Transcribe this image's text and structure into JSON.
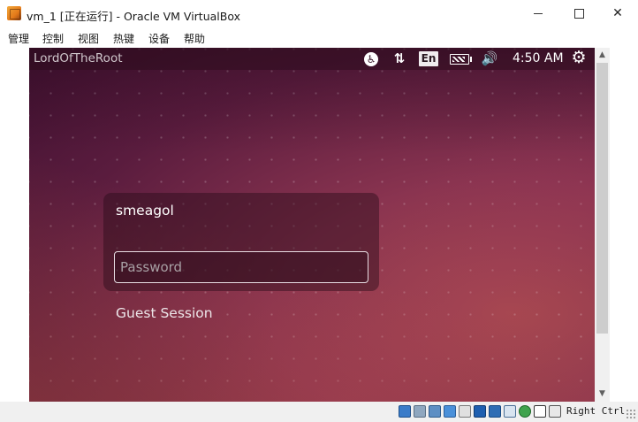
{
  "window": {
    "title": "vm_1 [正在运行] - Oracle VM VirtualBox",
    "app_icon": "virtualbox-icon"
  },
  "controls": {
    "minimize": "minimize",
    "maximize": "maximize",
    "close": "✕"
  },
  "menubar": {
    "items": [
      "管理",
      "控制",
      "视图",
      "热键",
      "设备",
      "帮助"
    ]
  },
  "vm": {
    "panel": {
      "hostname": "LordOfTheRoot",
      "accessibility_icon": "accessibility-icon",
      "network_icon": "network-updown-icon",
      "network_glyph": "⇅",
      "keyboard_layout": "En",
      "battery_icon": "battery-icon",
      "volume_icon": "volume-icon",
      "volume_glyph": "🔊",
      "clock": "4:50 AM",
      "power_icon": "gear-power-icon",
      "power_glyph": "⚙"
    },
    "login": {
      "username": "smeagol",
      "password_placeholder": "Password",
      "password_value": "",
      "guest_session": "Guest Session"
    },
    "wallpaper_colors": {
      "dark": "#3f1030",
      "mid": "#8a3450",
      "light": "#a8494f"
    }
  },
  "statusbar": {
    "host_key": "Right Ctrl",
    "icons": [
      "hard-disk-icon",
      "optical-drive-icon",
      "audio-icon",
      "network-icon",
      "usb-icon",
      "shared-folders-icon",
      "display-icon",
      "video-capture-icon",
      "cpu-virtualization-icon",
      "mouse-integration-icon",
      "keyboard-capture-icon"
    ]
  }
}
